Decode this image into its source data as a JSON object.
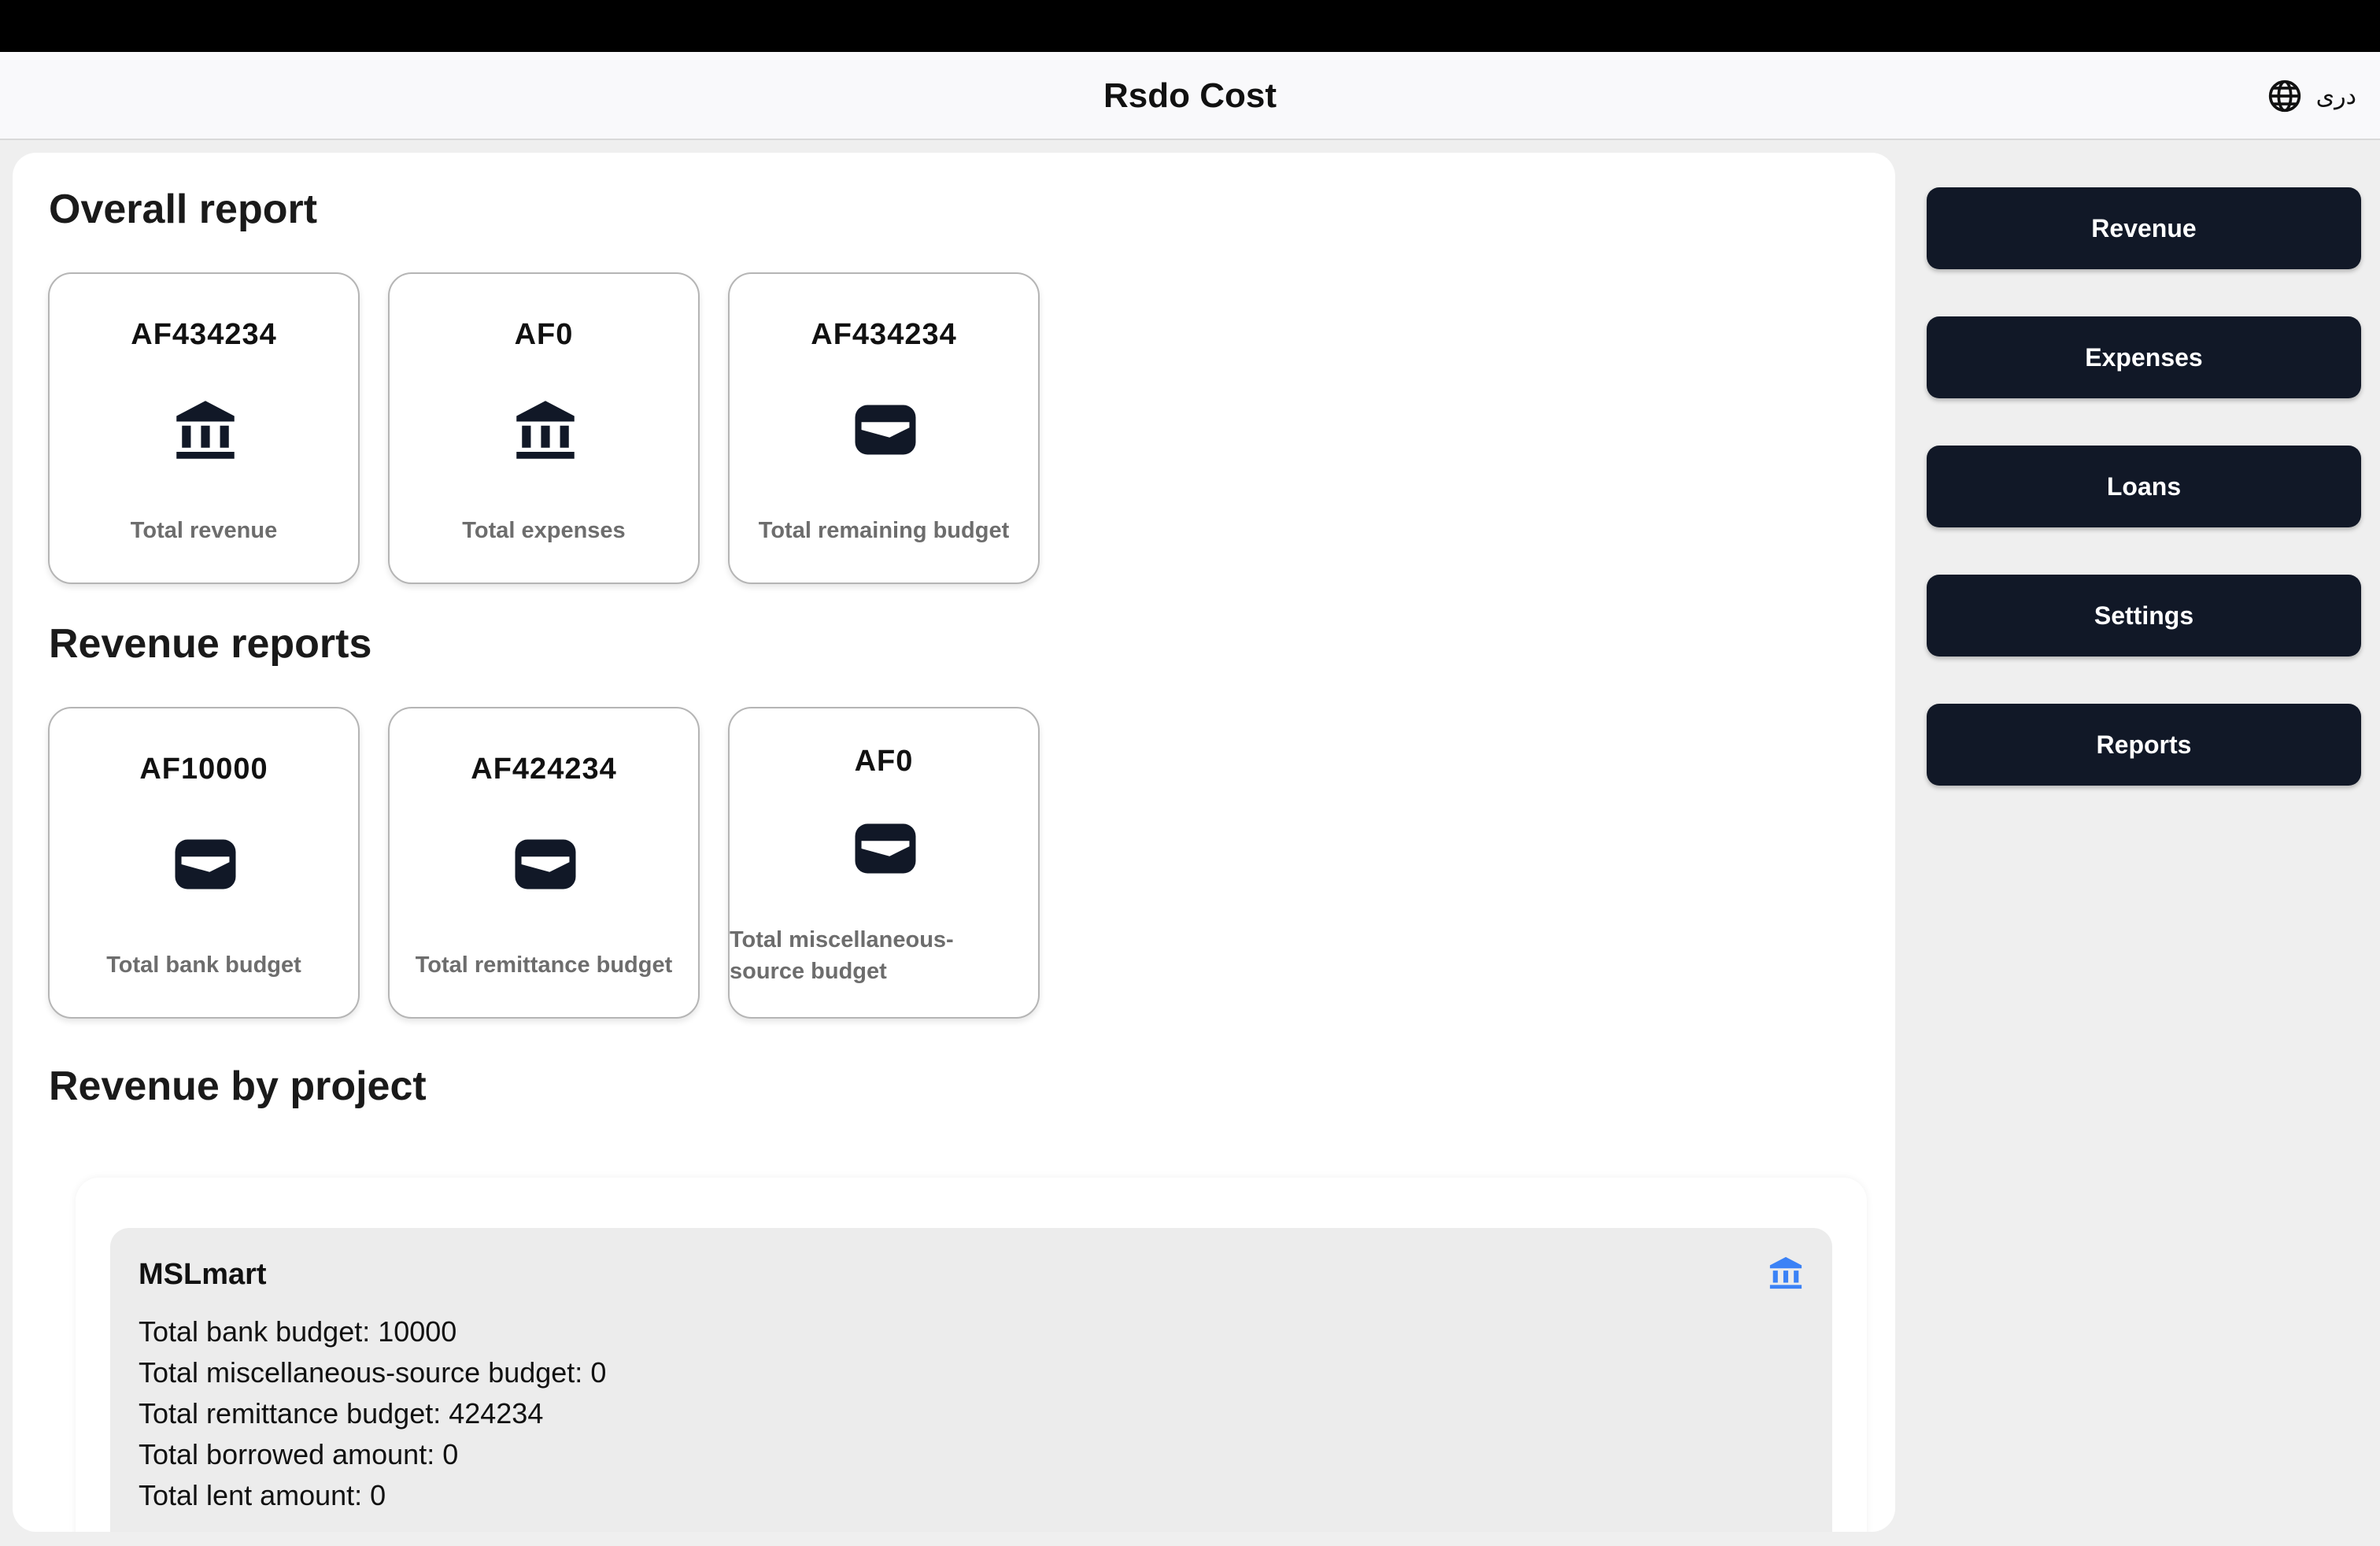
{
  "app": {
    "title": "Rsdo Cost"
  },
  "language": {
    "label": "دری",
    "icon": "globe-icon"
  },
  "overall": {
    "title": "Overall report",
    "cards": [
      {
        "value": "AF434234",
        "label": "Total revenue",
        "icon": "bank-icon"
      },
      {
        "value": "AF0",
        "label": "Total expenses",
        "icon": "bank-icon"
      },
      {
        "value": "AF434234",
        "label": "Total remaining budget",
        "icon": "wallet-icon"
      }
    ]
  },
  "revenue_reports": {
    "title": "Revenue reports",
    "cards": [
      {
        "value": "AF10000",
        "label": "Total bank budget",
        "icon": "wallet-icon"
      },
      {
        "value": "AF424234",
        "label": "Total remittance budget",
        "icon": "wallet-icon"
      },
      {
        "value": "AF0",
        "label": "Total miscellaneous-source budget",
        "icon": "wallet-icon"
      }
    ]
  },
  "revenue_by_project": {
    "title": "Revenue by project",
    "projects": [
      {
        "name": "MSLmart",
        "icon": "bank-icon",
        "lines": [
          "Total bank budget: 10000",
          "Total miscellaneous-source budget: 0",
          "Total remittance budget: 424234",
          "Total borrowed amount: 0",
          "Total lent amount: 0"
        ]
      }
    ]
  },
  "sidebar": {
    "items": [
      {
        "label": "Revenue"
      },
      {
        "label": "Expenses"
      },
      {
        "label": "Loans"
      },
      {
        "label": "Settings"
      },
      {
        "label": "Reports"
      }
    ]
  },
  "colors": {
    "button_bg": "#111827",
    "accent_icon": "#3b82f6",
    "muted_text": "#6d6d6d"
  }
}
